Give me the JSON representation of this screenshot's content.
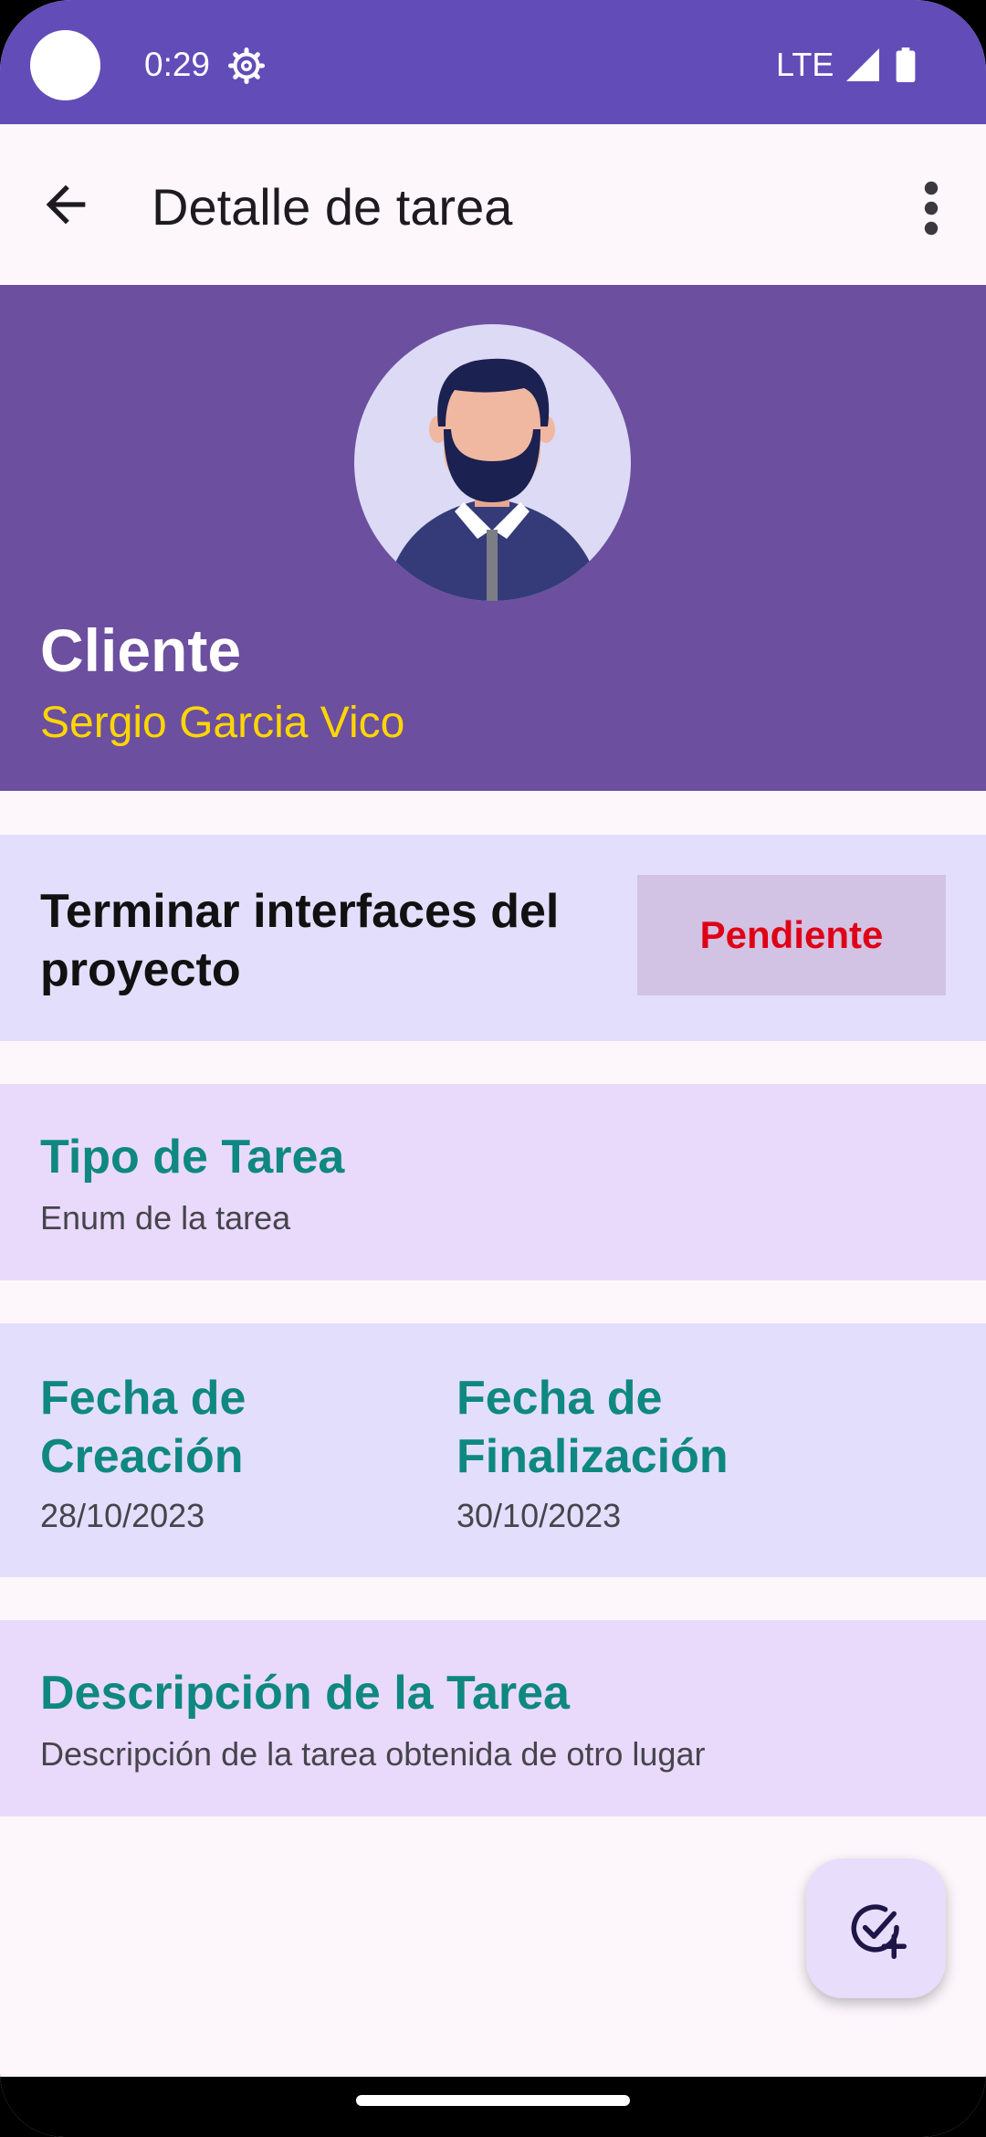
{
  "status_bar": {
    "time": "0:29",
    "network": "LTE",
    "icons": [
      "gear-icon",
      "signal-icon",
      "battery-icon"
    ]
  },
  "app_bar": {
    "title": "Detalle de tarea",
    "back_icon": "arrow-left-icon",
    "menu_icon": "more-vert-icon"
  },
  "client": {
    "label": "Cliente",
    "name": "Sergio Garcia Vico",
    "avatar_icon": "bearded-man-avatar"
  },
  "task": {
    "title": "Terminar interfaces del proyecto",
    "status": "Pendiente"
  },
  "task_type": {
    "title": "Tipo de Tarea",
    "value": "Enum de la tarea"
  },
  "dates": {
    "created_title": "Fecha de Creación",
    "created_value": "28/10/2023",
    "finished_title": "Fecha de Finalización",
    "finished_value": "30/10/2023"
  },
  "description": {
    "title": "Descripción de la Tarea",
    "value": "Descripción de la tarea obtenida de otro lugar"
  },
  "fab": {
    "icon": "check-circle-add-icon"
  },
  "colors": {
    "status_bar": "#624CB8",
    "header": "#6C4F9F",
    "client_name": "#FFD600",
    "status_text": "#E00016",
    "section_title": "#0E8880"
  }
}
